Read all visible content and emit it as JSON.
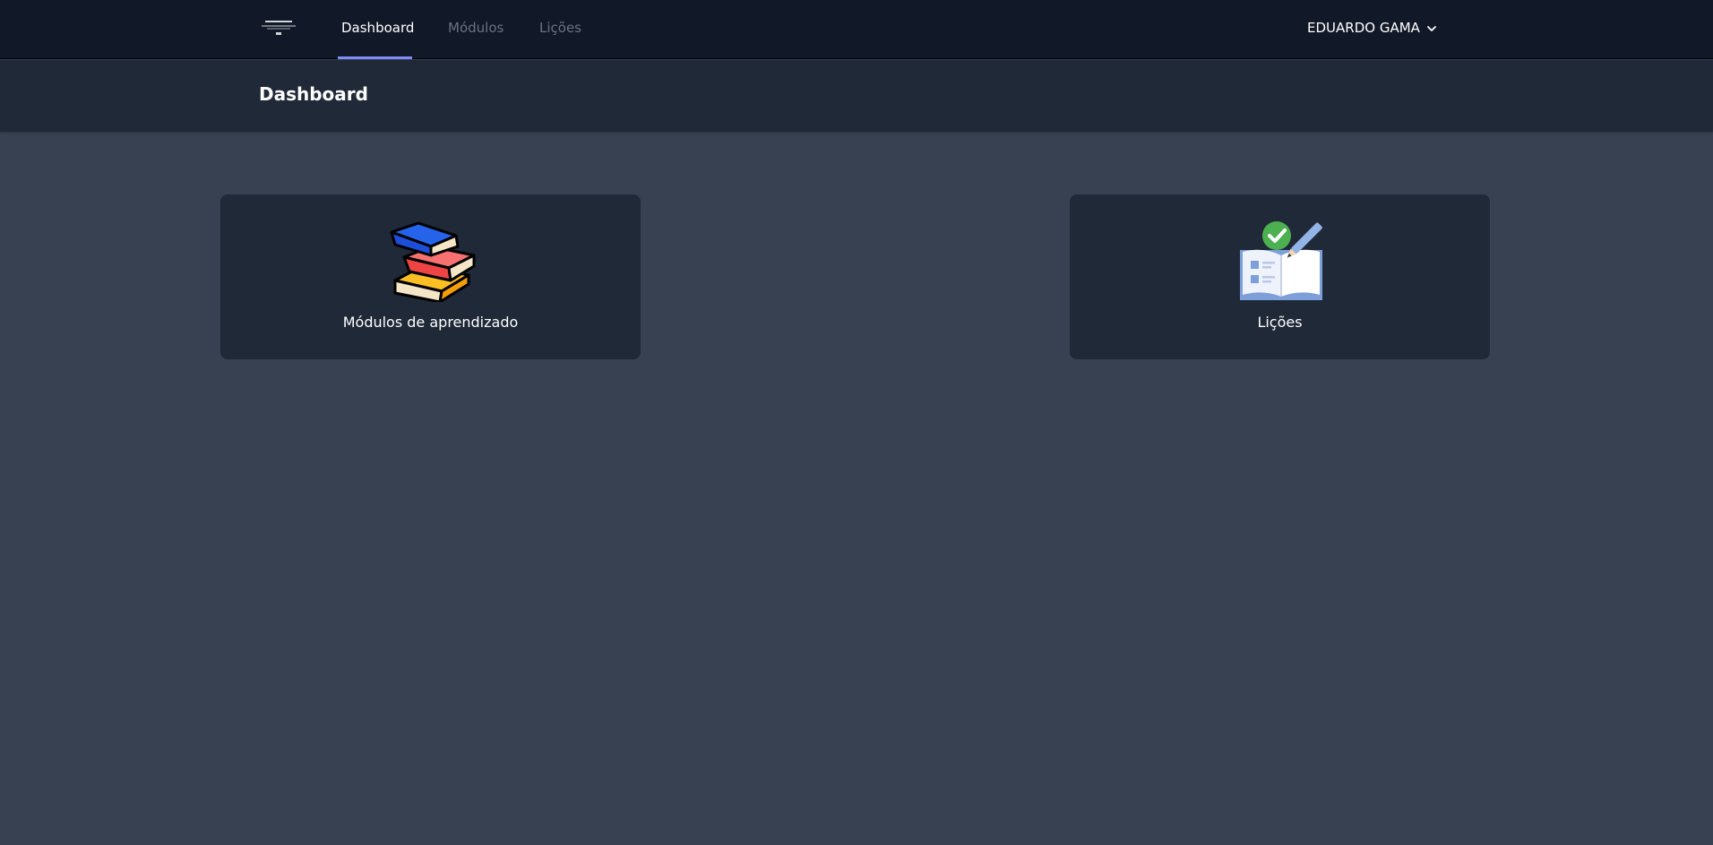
{
  "nav": {
    "logo_alt": "logo",
    "links": [
      {
        "label": "Dashboard",
        "active": true
      },
      {
        "label": "Módulos",
        "active": false
      },
      {
        "label": "Lições",
        "active": false
      }
    ],
    "user_name": "EDUARDO GAMA",
    "active_underline_color": "#818cf8"
  },
  "header": {
    "title": "Dashboard"
  },
  "cards": [
    {
      "label": "Módulos de aprendizado",
      "icon": "books-stack-icon"
    },
    {
      "label": "Lições",
      "icon": "lesson-book-check-icon"
    }
  ],
  "colors": {
    "nav_bg": "#111827",
    "header_bg": "#1f2937",
    "page_bg": "#374151",
    "card_bg": "#1f2937"
  }
}
